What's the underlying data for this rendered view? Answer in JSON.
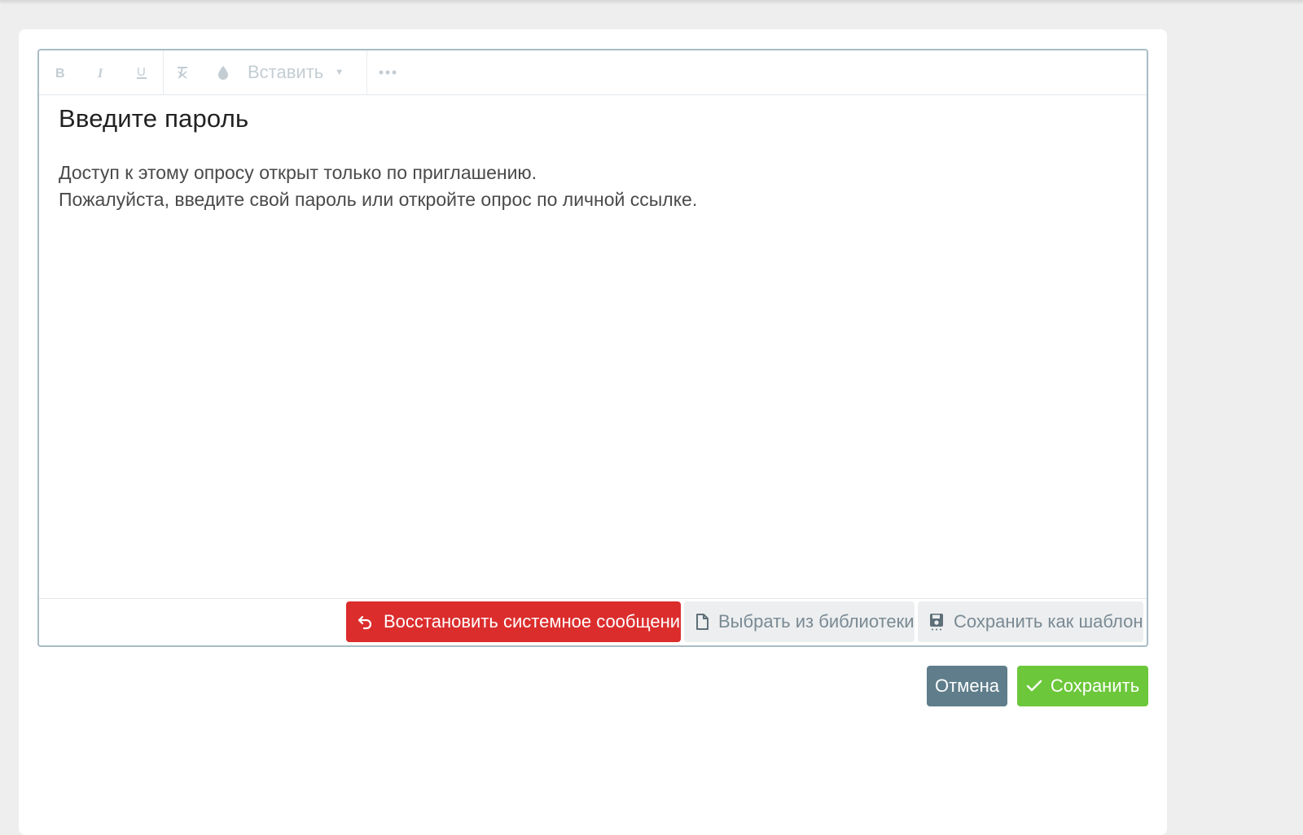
{
  "toolbar": {
    "bold_icon": "bold-icon",
    "italic_icon": "italic-icon",
    "underline_icon": "underline-icon",
    "clear_format_icon": "clear-format-icon",
    "color_icon": "color-drop-icon",
    "insert_label": "Вставить",
    "more_icon": "more-icon"
  },
  "content": {
    "heading": "Введите пароль",
    "line1": "Доступ к этому опросу открыт только по приглашению.",
    "line2": "Пожалуйста, введите свой пароль или откройте опрос по личной ссылке."
  },
  "editor_footer": {
    "restore_label": "Восстановить системное сообщение",
    "library_label": "Выбрать из библиотеки",
    "template_label": "Сохранить как шаблон"
  },
  "actions": {
    "cancel_label": "Отмена",
    "save_label": "Сохранить"
  },
  "colors": {
    "restore": "#dc2d2d",
    "cancel": "#5f7d8a",
    "save": "#6cc73a"
  }
}
